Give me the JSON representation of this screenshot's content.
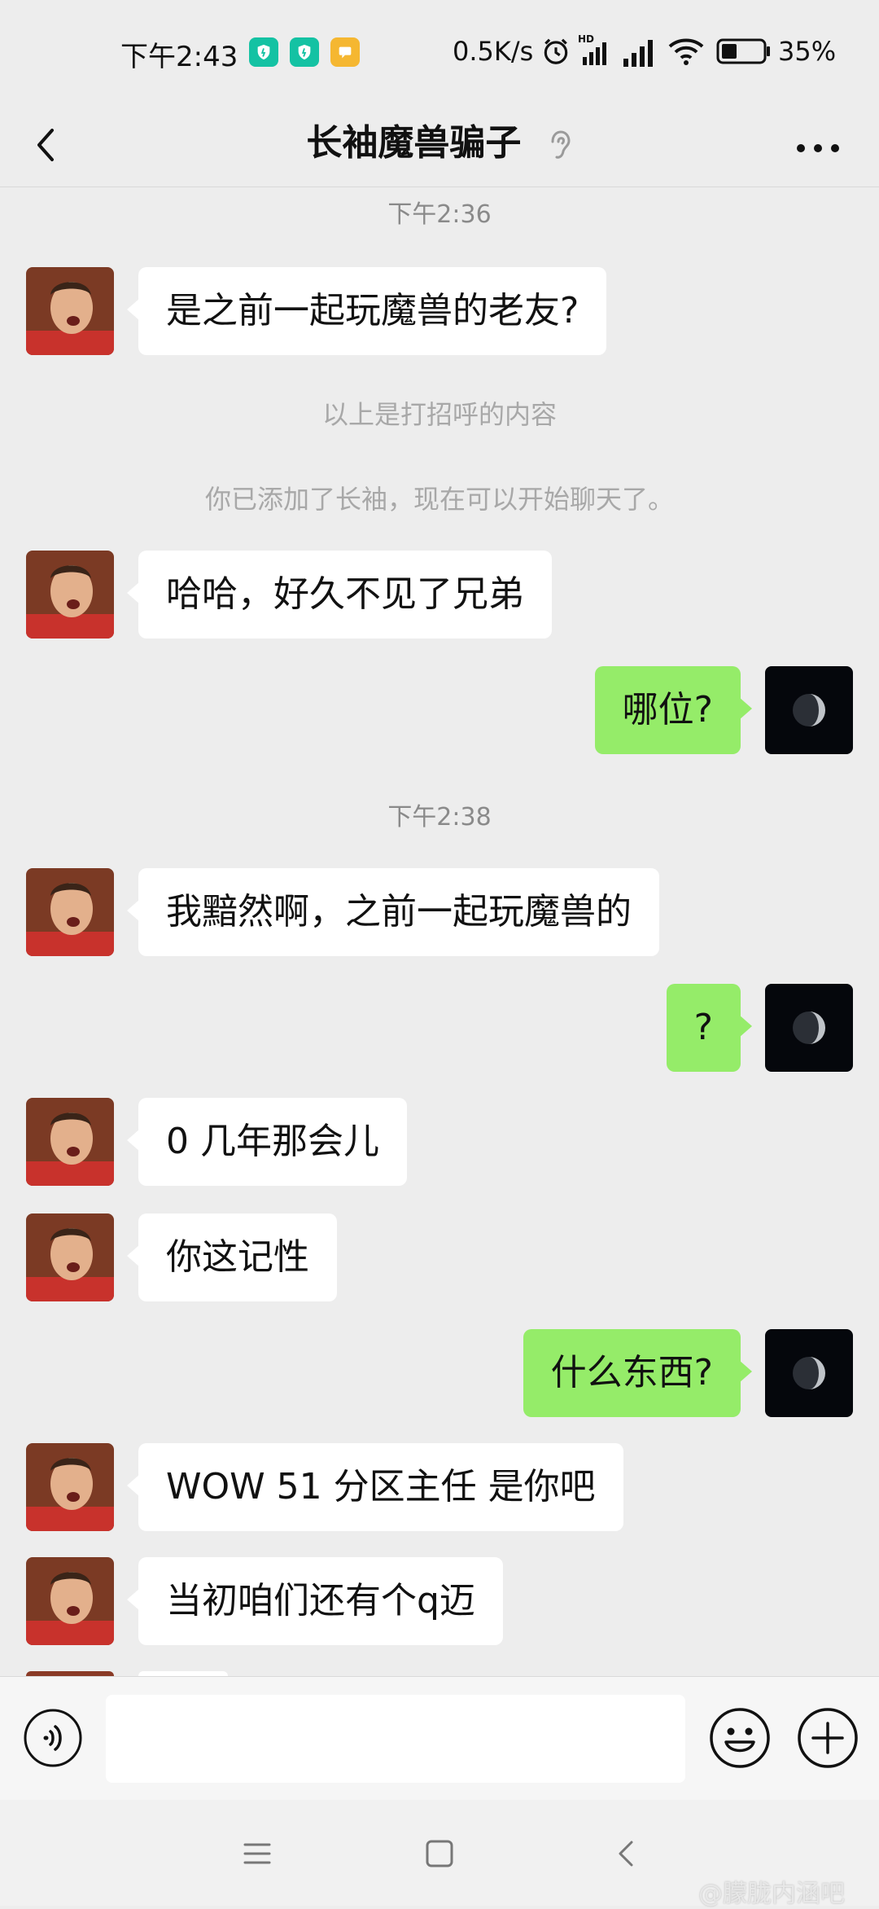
{
  "status_bar": {
    "time": "下午2:43",
    "network_speed": "0.5K/s",
    "battery_percent": "35%",
    "icons": [
      "shield-app-icon",
      "shield-app-icon",
      "message-app-icon",
      "alarm-icon",
      "hd-signal-icon",
      "signal-icon",
      "wifi-icon",
      "battery-icon"
    ]
  },
  "header": {
    "title": "长袖魔兽骗子",
    "icons": [
      "back-icon",
      "ear-icon",
      "more-icon"
    ]
  },
  "messages": [
    {
      "type": "timestamp",
      "text": "下午2:36"
    },
    {
      "type": "incoming",
      "text": "是之前一起玩魔兽的老友?"
    },
    {
      "type": "system",
      "text": "以上是打招呼的内容"
    },
    {
      "type": "system",
      "text": "你已添加了长袖，现在可以开始聊天了。"
    },
    {
      "type": "incoming",
      "text": "哈哈，好久不见了兄弟"
    },
    {
      "type": "outgoing",
      "text": "哪位?"
    },
    {
      "type": "timestamp",
      "text": "下午2:38"
    },
    {
      "type": "incoming",
      "text": "我黯然啊，之前一起玩魔兽的"
    },
    {
      "type": "outgoing",
      "text": "?"
    },
    {
      "type": "incoming",
      "text": "0 几年那会儿"
    },
    {
      "type": "incoming",
      "text": "你这记性"
    },
    {
      "type": "outgoing",
      "text": "什么东西?"
    },
    {
      "type": "incoming",
      "text": "WOW 51 分区主任 是你吧"
    },
    {
      "type": "incoming",
      "text": "当初咱们还有个q迈"
    }
  ],
  "input_bar": {
    "placeholder": "",
    "icons": [
      "voice-icon",
      "emoji-icon",
      "plus-icon"
    ]
  },
  "nav_bar": {
    "icons": [
      "menu-icon",
      "home-icon",
      "back-nav-icon"
    ]
  },
  "watermark": "@朦胧内涵吧",
  "colors": {
    "background": "#EDEDED",
    "outgoing_bubble": "#95EC69",
    "incoming_bubble": "#FFFFFF",
    "timestamp_text": "#8A8A8A"
  }
}
